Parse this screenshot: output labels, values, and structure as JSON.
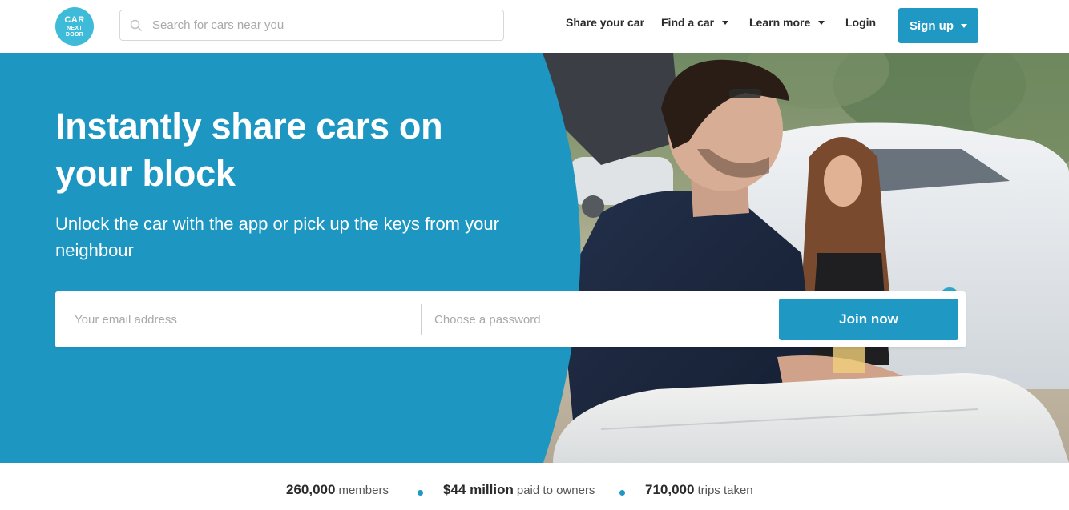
{
  "header": {
    "logo": {
      "line1": "CAR",
      "line2": "NEXT",
      "line3": "DOOR"
    },
    "search": {
      "placeholder": "Search for cars near you",
      "icon": "search-icon"
    },
    "nav": {
      "share": "Share your car",
      "find": "Find a car",
      "learn": "Learn more",
      "login": "Login",
      "signup": "Sign up"
    }
  },
  "hero": {
    "title": "Instantly share cars on your block",
    "subtitle": "Unlock the car with the app or pick up the keys from your neighbour",
    "form": {
      "email_placeholder": "Your email address",
      "password_placeholder": "Choose a password",
      "join_label": "Join now"
    }
  },
  "stats": [
    {
      "value": "260,000",
      "label": "members"
    },
    {
      "value": "$44 million",
      "label": "paid to owners"
    },
    {
      "value": "710,000",
      "label": "trips taken"
    }
  ],
  "colors": {
    "brand_blue": "#1d97c2",
    "button_blue": "#1f98c4",
    "logo_teal": "#3dbbd9"
  }
}
